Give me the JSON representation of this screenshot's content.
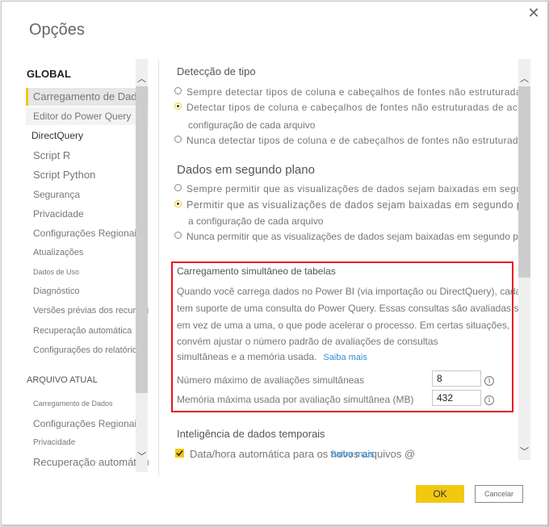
{
  "window": {
    "title": "Opções",
    "close_icon": "close-icon"
  },
  "sidebar": {
    "global_header": "GLOBAL",
    "global_items": [
      {
        "label": "Carregamento de Dados",
        "active": true
      },
      {
        "label": "Editor do Power Query"
      },
      {
        "label": "DirectQuery"
      },
      {
        "label": "Script R"
      },
      {
        "label": "Script Python"
      },
      {
        "label": "Segurança"
      },
      {
        "label": "Privacidade"
      },
      {
        "label": "Configurações Regionais"
      },
      {
        "label": "Atualizações"
      },
      {
        "label": "Dados de Uso"
      },
      {
        "label": "Diagnóstico"
      },
      {
        "label": "Versões prévias dos recursos"
      },
      {
        "label": "Recuperação automática"
      },
      {
        "label": "Configurações do relatório"
      }
    ],
    "file_header": "ARQUIVO ATUAL",
    "file_items": [
      {
        "label": "Carregamento de Dados"
      },
      {
        "label": "Configurações Regionais"
      },
      {
        "label": "Privacidade"
      },
      {
        "label": "Recuperação automática"
      }
    ],
    "scroll_up_icon": "chevron-up-icon",
    "scroll_down_icon": "chevron-down-icon"
  },
  "main": {
    "type_detection": {
      "title": "Detecção de tipo",
      "options": [
        {
          "label": "Sempre detectar tipos de coluna e cabeçalhos de fontes não estruturadas",
          "selected": false
        },
        {
          "label": "Detectar tipos de coluna e cabeçalhos de fontes não estruturadas de acordo com a",
          "continuation": "configuração de cada arquivo",
          "selected": true
        },
        {
          "label": "Nunca detectar tipos de coluna e de cabeçalhos de fontes não estruturadas",
          "selected": false
        }
      ]
    },
    "background_data": {
      "title": "Dados em segundo plano",
      "options": [
        {
          "label": "Sempre permitir que as visualizações de dados sejam baixadas em segundo plano",
          "selected": false
        },
        {
          "label": "Permitir que as visualizações de dados sejam baixadas em segundo plano, de acordo com",
          "continuation": "a configuração de cada arquivo",
          "selected": true
        },
        {
          "label": "Nunca permitir que as visualizações de dados sejam baixadas em segundo plano",
          "selected": false
        }
      ]
    },
    "parallel_loading": {
      "title": "Carregamento simultâneo de tabelas",
      "description_lines": [
        "Quando você carrega dados no Power BI (via importação ou DirectQuery), cada tabela",
        "tem suporte de uma consulta do Power Query. Essas consultas são avaliadas simultaneamente",
        "em vez de uma a uma, o que pode acelerar o processo. Em certas situações,",
        "convém ajustar o número padrão de avaliações de consultas",
        "simultâneas e a memória usada."
      ],
      "learn_more": "Saiba mais",
      "max_evaluations_label": "Número máximo de avaliações simultâneas",
      "max_evaluations_value": "8",
      "max_memory_label": "Memória máxima usada por avaliação simultânea (MB)",
      "max_memory_value": "432",
      "info_icon": "i"
    },
    "time_intelligence": {
      "title": "Inteligência de dados temporais",
      "auto_datetime_label": "Data/hora automática para os novos arquivos @",
      "auto_datetime_checked": true,
      "learn_more": "Saiba mais"
    }
  },
  "footer": {
    "ok_label": "OK",
    "cancel_label": "Cancelar"
  },
  "colors": {
    "accent": "#f2c811",
    "highlight_border": "#e81123",
    "link": "#2f8fd8"
  }
}
